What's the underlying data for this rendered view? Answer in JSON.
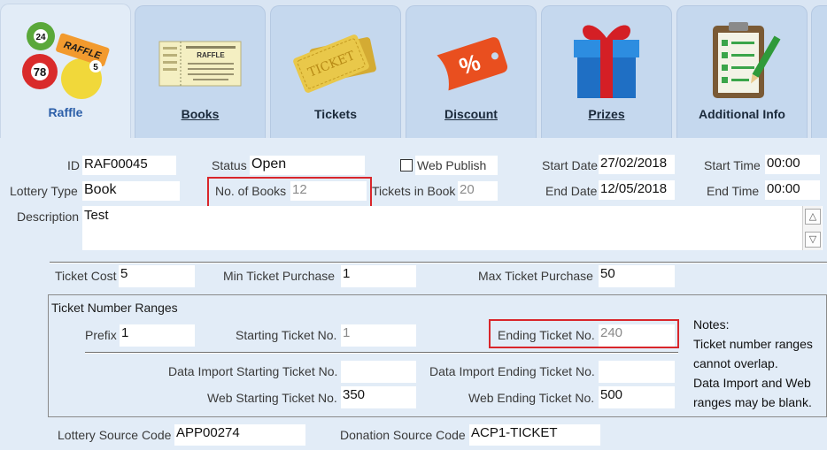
{
  "tabs": [
    {
      "key": "raffle",
      "label": "Raffle",
      "active": true
    },
    {
      "key": "books",
      "label": "Books",
      "active": false
    },
    {
      "key": "tickets",
      "label": "Tickets",
      "active": false
    },
    {
      "key": "discount",
      "label": "Discount",
      "active": false
    },
    {
      "key": "prizes",
      "label": "Prizes",
      "active": false
    },
    {
      "key": "additional",
      "label": "Additional Info",
      "active": false
    }
  ],
  "icons": {
    "raffle_balls": [
      "24",
      "78",
      "5"
    ],
    "raffle_tag": "RAFFLE",
    "ticket_text": "TICKET",
    "ticket_stub": "RAFFLE",
    "discount_symbol": "%"
  },
  "colors": {
    "accent": "#2b5ea8",
    "highlight": "#d9262b"
  },
  "form": {
    "id_label": "ID",
    "id_value": "RAF00045",
    "status_label": "Status",
    "status_value": "Open",
    "web_publish_label": "Web Publish",
    "web_publish_checked": false,
    "start_date_label": "Start Date",
    "start_date_value": "27/02/2018",
    "start_time_label": "Start Time",
    "start_time_value": "00:00",
    "lottery_type_label": "Lottery Type",
    "lottery_type_value": "Book",
    "num_books_label": "No. of Books",
    "num_books_value": "12",
    "tickets_in_book_label": "Tickets in Book",
    "tickets_in_book_value": "20",
    "end_date_label": "End Date",
    "end_date_value": "12/05/2018",
    "end_time_label": "End Time",
    "end_time_value": "00:00",
    "description_label": "Description",
    "description_value": "Test",
    "ticket_cost_label": "Ticket Cost",
    "ticket_cost_value": "5",
    "min_purchase_label": "Min Ticket Purchase",
    "min_purchase_value": "1",
    "max_purchase_label": "Max Ticket Purchase",
    "max_purchase_value": "50"
  },
  "ranges": {
    "title": "Ticket Number Ranges",
    "prefix_label": "Prefix",
    "prefix_value": "1",
    "start_label": "Starting Ticket No.",
    "start_value": "1",
    "end_label": "Ending Ticket No.",
    "end_value": "240",
    "import_start_label": "Data Import Starting Ticket No.",
    "import_start_value": "",
    "import_end_label": "Data Import Ending Ticket No.",
    "import_end_value": "",
    "web_start_label": "Web Starting Ticket No.",
    "web_start_value": "350",
    "web_end_label": "Web Ending Ticket No.",
    "web_end_value": "500",
    "notes": [
      "Notes:",
      "Ticket number ranges",
      "cannot overlap.",
      "Data Import and Web",
      "ranges may be blank."
    ]
  },
  "source": {
    "lottery_label": "Lottery Source Code",
    "lottery_value": "APP00274",
    "donation_label": "Donation Source Code",
    "donation_value": "ACP1-TICKET"
  }
}
